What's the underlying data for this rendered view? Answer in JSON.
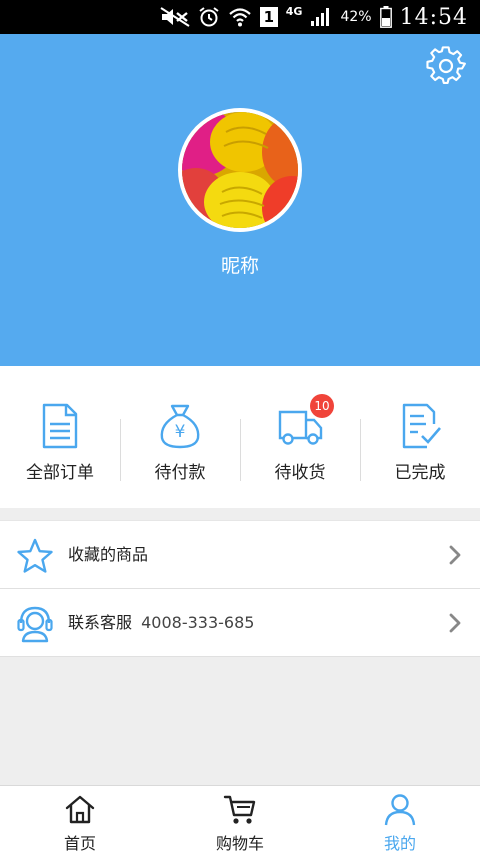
{
  "status_bar": {
    "network": "4G",
    "sim": "1",
    "battery": "42%",
    "time": "14:54"
  },
  "profile": {
    "nickname": "昵称"
  },
  "orders": [
    {
      "label": "全部订单",
      "icon": "document-icon"
    },
    {
      "label": "待付款",
      "icon": "money-bag-icon"
    },
    {
      "label": "待收货",
      "icon": "delivery-truck-icon",
      "badge": "10"
    },
    {
      "label": "已完成",
      "icon": "document-check-icon"
    }
  ],
  "menu": {
    "favorites": "收藏的商品",
    "support": "联系客服",
    "support_phone": "4008-333-685"
  },
  "tabs": [
    {
      "label": "首页",
      "icon": "home-icon"
    },
    {
      "label": "购物车",
      "icon": "cart-icon"
    },
    {
      "label": "我的",
      "icon": "user-icon"
    }
  ],
  "colors": {
    "header": "#55aaef",
    "accent": "#4aa7ee",
    "badge": "#f0443a"
  }
}
